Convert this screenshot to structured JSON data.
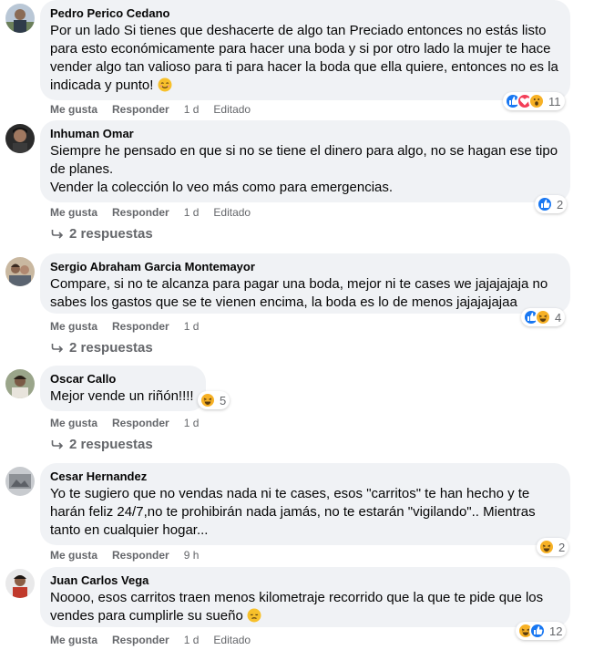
{
  "comments": [
    {
      "author": "Pedro Perico Cedano",
      "text": "Por un lado Si tienes que deshacerte de algo tan Preciado entonces no estás listo para esto económicamente para hacer una boda y si por otro lado la mujer te hace vender algo tan valioso para ti para hacer la boda que ella quiere, entonces no es la indicada y punto!",
      "text_emoji": "smiling-face-icon",
      "like_label": "Me gusta",
      "reply_label": "Responder",
      "time": "1 d",
      "edited": "Editado",
      "reactions": [
        "like",
        "love",
        "wow"
      ],
      "reaction_count": "11"
    },
    {
      "author": "Inhuman Omar",
      "text": "Siempre he pensado en que si no se tiene el dinero para algo, no se hagan ese tipo de planes.\nVender la colección lo veo más como para emergencias.",
      "like_label": "Me gusta",
      "reply_label": "Responder",
      "time": "1 d",
      "edited": "Editado",
      "reactions": [
        "like"
      ],
      "reaction_count": "2",
      "replies_label": "2 respuestas"
    },
    {
      "author": "Sergio Abraham Garcia Montemayor",
      "text": "Compare, si no te alcanza para pagar una boda, mejor ni te cases we jajajajaja no sabes los gastos que se te vienen encima, la boda es lo de menos jajajajajaa",
      "like_label": "Me gusta",
      "reply_label": "Responder",
      "time": "1 d",
      "reactions": [
        "like",
        "haha"
      ],
      "reaction_count": "4",
      "replies_label": "2 respuestas"
    },
    {
      "author": "Oscar Callo",
      "text": "Mejor vende un riñón!!!!",
      "like_label": "Me gusta",
      "reply_label": "Responder",
      "time": "1 d",
      "reactions": [
        "haha"
      ],
      "reaction_count": "5",
      "replies_label": "2 respuestas"
    },
    {
      "author": "Cesar Hernandez",
      "text": "Yo te sugiero que no vendas nada ni te cases, esos \"carritos\" te han hecho y te harán feliz 24/7,no te prohibirán nada jamás, no te estarán \"vigilando\".. Mientras tanto en cualquier hogar...",
      "like_label": "Me gusta",
      "reply_label": "Responder",
      "time": "9 h",
      "reactions": [
        "haha"
      ],
      "reaction_count": "2"
    },
    {
      "author": "Juan Carlos Vega",
      "text": "Noooo, esos carritos traen menos kilometraje recorrido que la que te pide que los vendes para cumplirle su sueño",
      "text_emoji": "sad-face-icon",
      "like_label": "Me gusta",
      "reply_label": "Responder",
      "time": "1 d",
      "edited": "Editado",
      "reactions": [
        "haha",
        "like"
      ],
      "reaction_count": "12"
    }
  ],
  "colors": {
    "bubble": "#f0f2f5",
    "meta_text": "#65676b",
    "like": "#1877f2",
    "love": "#f33e58",
    "haha": "#f7b125"
  }
}
